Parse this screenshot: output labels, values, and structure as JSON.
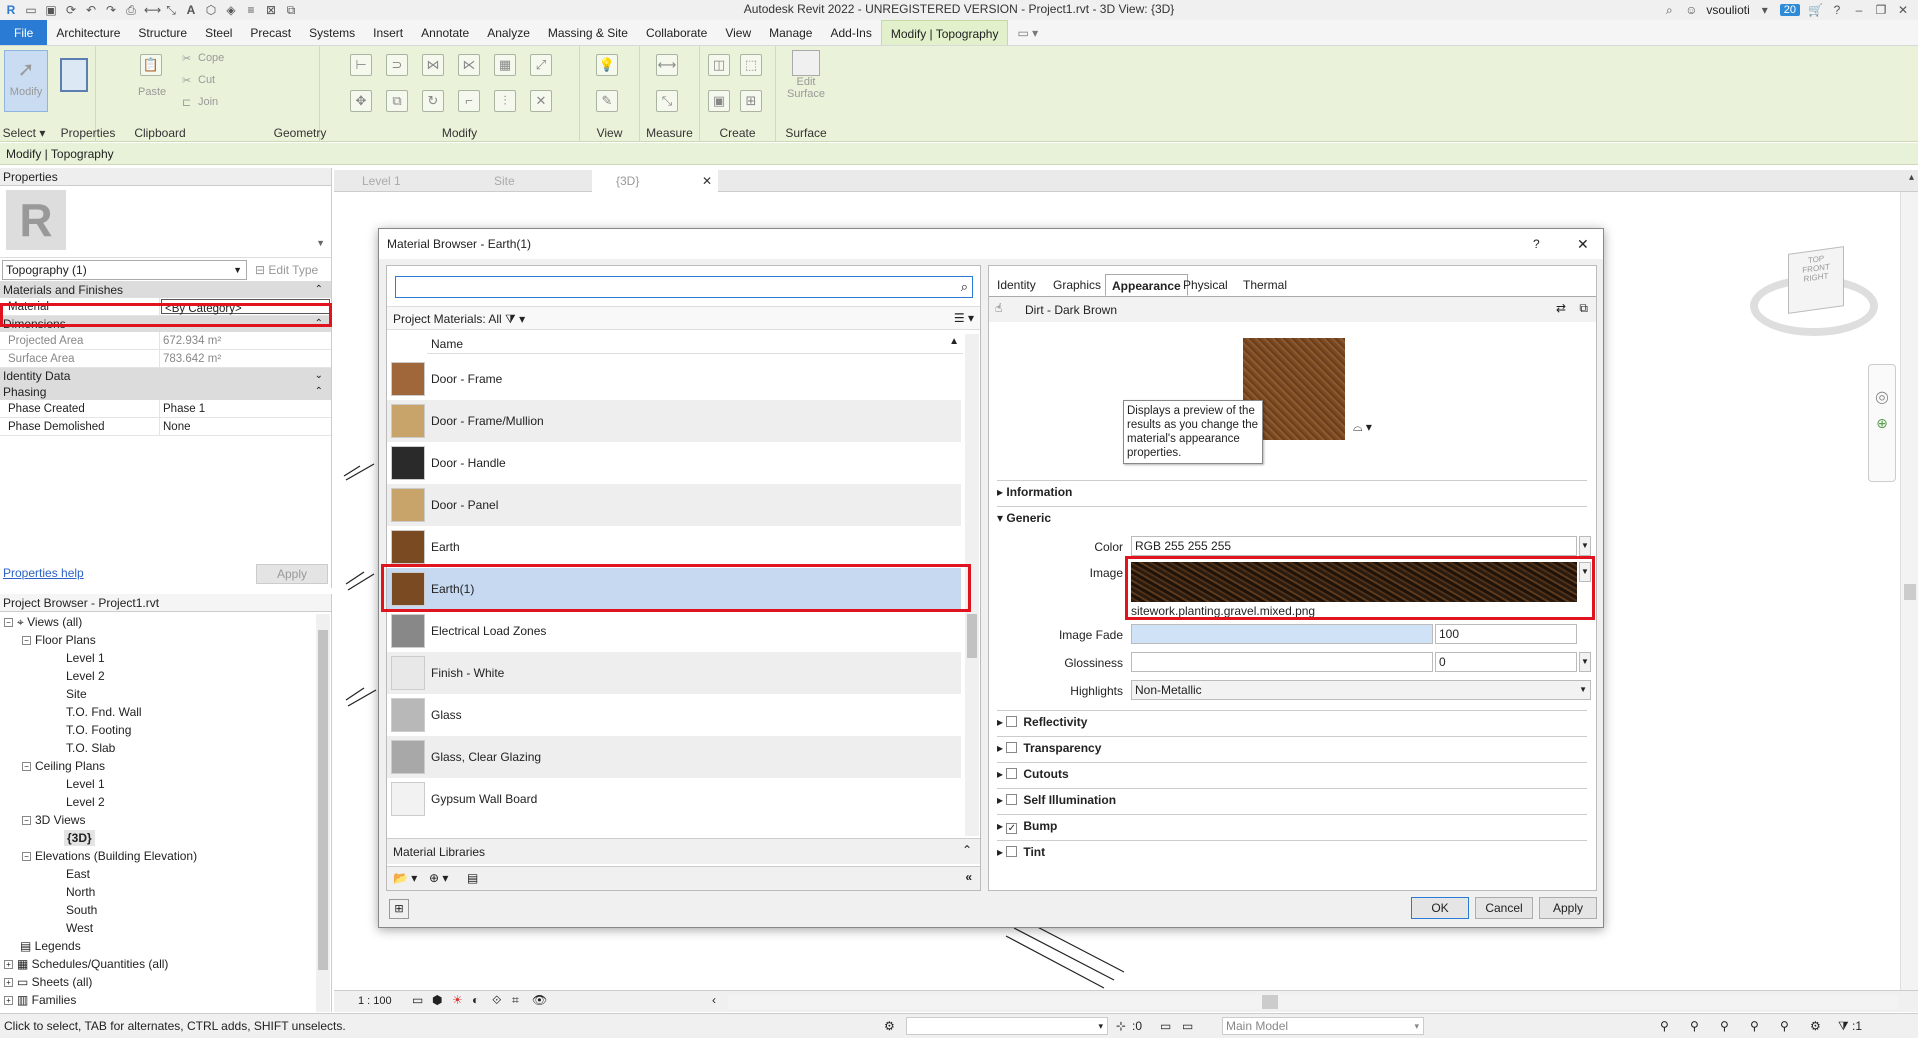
{
  "window": {
    "title": "Autodesk Revit 2022 - UNREGISTERED VERSION - Project1.rvt - 3D View: {3D}",
    "user": "vsoulioti",
    "notifications": "20"
  },
  "ribbon_tabs": [
    "File",
    "Architecture",
    "Structure",
    "Steel",
    "Precast",
    "Systems",
    "Insert",
    "Annotate",
    "Analyze",
    "Massing & Site",
    "Collaborate",
    "View",
    "Manage",
    "Add-Ins",
    "Modify | Topography"
  ],
  "ribbon": {
    "modify_label": "Modify",
    "select_label": "Select",
    "properties_label": "Properties",
    "paste_label": "Paste",
    "clipboard_label": "Clipboard",
    "cope_label": "Cope",
    "cut_label": "Cut",
    "join_label": "Join",
    "geometry_label": "Geometry",
    "modify_group_label": "Modify",
    "view_label": "View",
    "measure_label": "Measure",
    "create_label": "Create",
    "edit_surface_label_1": "Edit",
    "edit_surface_label_2": "Surface",
    "surface_label": "Surface"
  },
  "context_bar": "Modify | Topography",
  "properties": {
    "title": "Properties",
    "type_selector": "Topography (1)",
    "edit_type": "Edit Type",
    "sections": {
      "materials": "Materials and Finishes",
      "dimensions": "Dimensions",
      "identity": "Identity Data",
      "phasing": "Phasing"
    },
    "rows": {
      "material_k": "Material",
      "material_v": "<By Category>",
      "projected_k": "Projected Area",
      "projected_v": "672.934 m²",
      "surface_k": "Surface Area",
      "surface_v": "783.642 m²",
      "phase_created_k": "Phase Created",
      "phase_created_v": "Phase 1",
      "phase_demolished_k": "Phase Demolished",
      "phase_demolished_v": "None"
    },
    "help": "Properties help",
    "apply": "Apply"
  },
  "project_browser": {
    "title": "Project Browser - Project1.rvt",
    "views_all": "Views (all)",
    "floor_plans": "Floor Plans",
    "fp": [
      "Level 1",
      "Level 2",
      "Site",
      "T.O. Fnd. Wall",
      "T.O. Footing",
      "T.O. Slab"
    ],
    "ceiling_plans": "Ceiling Plans",
    "cp": [
      "Level 1",
      "Level 2"
    ],
    "views_3d": "3D Views",
    "v3d": "{3D}",
    "elevations": "Elevations (Building Elevation)",
    "elev": [
      "East",
      "North",
      "South",
      "West"
    ],
    "legends": "Legends",
    "schedules": "Schedules/Quantities (all)",
    "sheets": "Sheets (all)",
    "families": "Families"
  },
  "view_tabs": [
    "Level 1",
    "Site",
    "{3D}"
  ],
  "dialog": {
    "title": "Material Browser - Earth(1)",
    "help": "?",
    "filter": "Project Materials: All",
    "col_name": "Name",
    "materials": [
      {
        "name": "Door - Frame",
        "color": "#a0683a"
      },
      {
        "name": "Door - Frame/Mullion",
        "color": "#c9a46a"
      },
      {
        "name": "Door - Handle",
        "color": "#2a2a2a"
      },
      {
        "name": "Door - Panel",
        "color": "#c9a46a"
      },
      {
        "name": "Earth",
        "color": "#7a4a22"
      },
      {
        "name": "Earth(1)",
        "color": "#7a4a22"
      },
      {
        "name": "Electrical Load Zones",
        "color": "#888888"
      },
      {
        "name": "Finish - White",
        "color": "#e8e8e8"
      },
      {
        "name": "Glass",
        "color": "#b8b8b8"
      },
      {
        "name": "Glass, Clear Glazing",
        "color": "#a8a8a8"
      },
      {
        "name": "Gypsum Wall Board",
        "color": "#f2f2f2"
      }
    ],
    "libraries": "Material Libraries",
    "right_tabs": [
      "Identity",
      "Graphics",
      "Appearance",
      "Physical",
      "Thermal"
    ],
    "asset_name": "Dirt - Dark Brown",
    "tooltip": "Displays a preview of the results as you change the material's appearance properties.",
    "information": "Information",
    "generic": "Generic",
    "color_label": "Color",
    "color_value": "RGB 255 255 255",
    "image_label": "Image",
    "image_file": "sitework.planting.gravel.mixed.png",
    "image_fade_label": "Image Fade",
    "image_fade_value": "100",
    "glossiness_label": "Glossiness",
    "glossiness_value": "0",
    "highlights_label": "Highlights",
    "highlights_value": "Non-Metallic",
    "sections": [
      {
        "name": "Reflectivity",
        "checked": false
      },
      {
        "name": "Transparency",
        "checked": false
      },
      {
        "name": "Cutouts",
        "checked": false
      },
      {
        "name": "Self Illumination",
        "checked": false
      },
      {
        "name": "Bump",
        "checked": true
      },
      {
        "name": "Tint",
        "checked": false
      }
    ],
    "ok": "OK",
    "cancel": "Cancel",
    "apply": "Apply"
  },
  "view_control": {
    "scale": "1 : 100"
  },
  "status": {
    "message": "Click to select, TAB for alternates, CTRL adds, SHIFT unselects.",
    "zero": ":0",
    "model": "Main Model",
    "filter_count": ":1"
  },
  "viewcube": {
    "top": "TOP",
    "front": "FRONT",
    "right": "RIGHT"
  },
  "colors": {
    "accent": "#2a7bd3",
    "ribbon": "#eaf3da",
    "highlight_red": "#e0141e",
    "selected_row": "#c6d9f1"
  }
}
